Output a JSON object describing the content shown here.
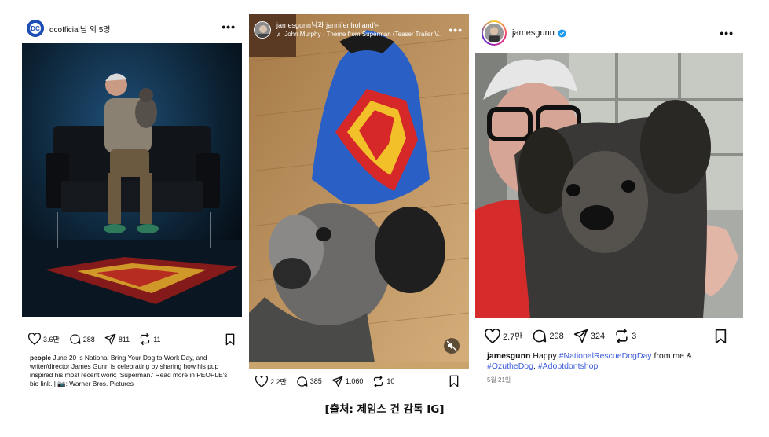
{
  "posts": [
    {
      "account": "dcofficial",
      "coauthor_suffix": "님 외 5명",
      "likes": "3.6만",
      "comments": "288",
      "shares": "811",
      "reposts": "11",
      "caption_user": "people",
      "caption_text": "June 20 is National Bring Your Dog to Work Day, and writer/director James Gunn is celebrating by sharing how his pup inspired his most recent work: 'Superman.' Read more in PEOPLE's bio link. | 📷: Warner Bros. Pictures"
    },
    {
      "account": "jamesgunn",
      "coauthor_joiner": "님과 ",
      "coauthor": "jenniferlholland",
      "coauthor_suffix": "님",
      "music": "John Murphy · Theme from Superman (Teaser Trailer V...",
      "likes": "2.2만",
      "comments": "385",
      "shares": "1,060",
      "reposts": "10"
    },
    {
      "account": "jamesgunn",
      "likes": "2.7만",
      "comments": "298",
      "shares": "324",
      "reposts": "3",
      "caption_user": "jamesgunn",
      "caption_pre": "Happy ",
      "caption_tag1": "#NationalRescueDogDay",
      "caption_mid": " from me & ",
      "caption_tag2": "#OzutheDog",
      "caption_dot": ". ",
      "caption_tag3": "#Adoptdontshop",
      "date": "5월 21일"
    }
  ],
  "source_label": "[출처: 제임스 건 감독 IG]",
  "colors": {
    "link": "#3b5bdb",
    "verified": "#1d9bf0",
    "superman_red": "#d62828",
    "superman_yellow": "#f2c028"
  },
  "icons": [
    "heart-icon",
    "comment-icon",
    "share-icon",
    "repost-icon",
    "bookmark-icon",
    "more-icon",
    "music-icon",
    "mute-icon",
    "verified-icon"
  ]
}
